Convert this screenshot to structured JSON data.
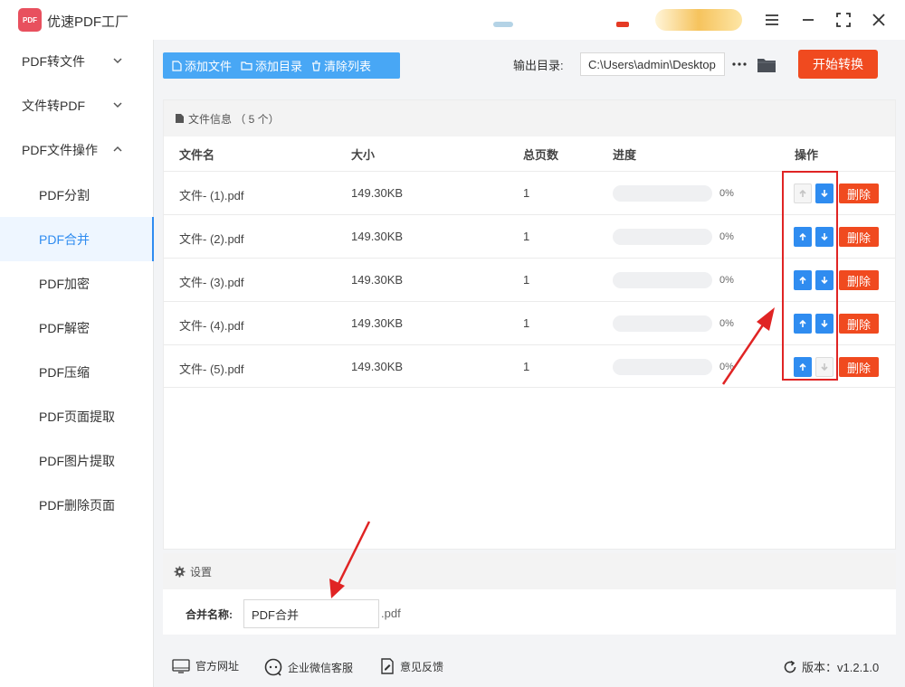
{
  "app": {
    "title": "优速PDF工厂",
    "logo_text": "PDF"
  },
  "sidebar": {
    "groups": [
      {
        "label": "PDF转文件"
      },
      {
        "label": "文件转PDF"
      },
      {
        "label": "PDF文件操作"
      }
    ],
    "items": [
      {
        "label": "PDF分割",
        "active": false
      },
      {
        "label": "PDF合并",
        "active": true
      },
      {
        "label": "PDF加密",
        "active": false
      },
      {
        "label": "PDF解密",
        "active": false
      },
      {
        "label": "PDF压缩",
        "active": false
      },
      {
        "label": "PDF页面提取",
        "active": false
      },
      {
        "label": "PDF图片提取",
        "active": false
      },
      {
        "label": "PDF删除页面",
        "active": false
      }
    ]
  },
  "toolbar": {
    "add_file": "添加文件",
    "add_folder": "添加目录",
    "clear_list": "清除列表",
    "output_label": "输出目录:",
    "output_path": "C:\\Users\\admin\\Desktop",
    "start": "开始转换"
  },
  "file_panel": {
    "title": "文件信息 （ 5 个）",
    "columns": {
      "name": "文件名",
      "size": "大小",
      "pages": "总页数",
      "progress": "进度",
      "actions": "操作"
    },
    "delete_label": "删除",
    "rows": [
      {
        "name": "文件- (1).pdf",
        "size": "149.30KB",
        "pages": "1",
        "progress": 0,
        "percent": "0%",
        "up_enabled": false,
        "down_enabled": true
      },
      {
        "name": "文件- (2).pdf",
        "size": "149.30KB",
        "pages": "1",
        "progress": 0,
        "percent": "0%",
        "up_enabled": true,
        "down_enabled": true
      },
      {
        "name": "文件- (3).pdf",
        "size": "149.30KB",
        "pages": "1",
        "progress": 0,
        "percent": "0%",
        "up_enabled": true,
        "down_enabled": true
      },
      {
        "name": "文件- (4).pdf",
        "size": "149.30KB",
        "pages": "1",
        "progress": 0,
        "percent": "0%",
        "up_enabled": true,
        "down_enabled": true
      },
      {
        "name": "文件- (5).pdf",
        "size": "149.30KB",
        "pages": "1",
        "progress": 0,
        "percent": "0%",
        "up_enabled": true,
        "down_enabled": false
      }
    ]
  },
  "settings": {
    "title": "设置",
    "merge_label": "合并名称:",
    "merge_value": "PDF合并",
    "merge_ext": ".pdf"
  },
  "footer": {
    "website": "官方网址",
    "wechat": "企业微信客服",
    "feedback": "意见反馈",
    "version": "版本：v1.2.1.0"
  },
  "colors": {
    "primary": "#2f8cf0",
    "toolbar": "#48a7f5",
    "danger": "#f04a1f",
    "annotation": "#e02424"
  },
  "icons": [
    "menu-icon",
    "fullscreen-icon",
    "close-icon",
    "chevron-down-icon",
    "chevron-up-icon",
    "file-icon",
    "folder-icon",
    "trash-icon",
    "more-icon",
    "gear-icon",
    "arrow-up-icon",
    "arrow-down-icon",
    "refresh-icon"
  ]
}
